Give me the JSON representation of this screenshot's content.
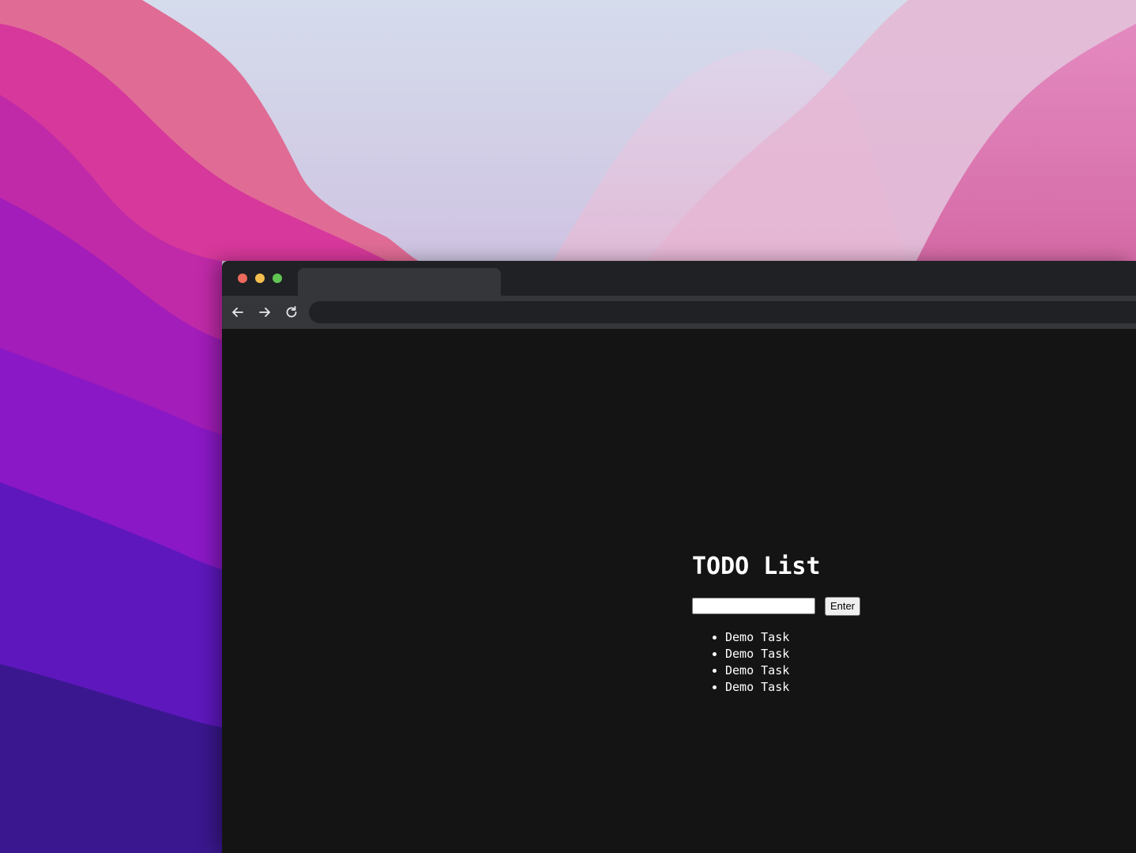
{
  "browser": {
    "tab_title": "",
    "address": ""
  },
  "page": {
    "title": "TODO List",
    "input": {
      "value": "",
      "placeholder": ""
    },
    "enter_label": "Enter",
    "tasks": [
      "Demo Task",
      "Demo Task",
      "Demo Task",
      "Demo Task"
    ]
  },
  "colors": {
    "page_background": "#141414",
    "tabbar": "#202124",
    "toolbar": "#35363a",
    "text": "#ffffff"
  },
  "icons": {
    "back": "arrow-left-icon",
    "forward": "arrow-right-icon",
    "reload": "reload-icon"
  }
}
